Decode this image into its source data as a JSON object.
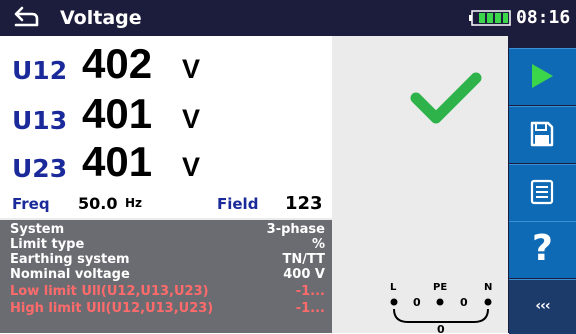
{
  "header": {
    "title": "Voltage",
    "time": "08:16",
    "back_icon": "back-arrow-icon",
    "battery_icon": "battery-icon"
  },
  "measurements": [
    {
      "name": "U12",
      "value": "402",
      "unit": "V"
    },
    {
      "name": "U13",
      "value": "401",
      "unit": "V"
    },
    {
      "name": "U23",
      "value": "401",
      "unit": "V"
    }
  ],
  "freq": {
    "label": "Freq",
    "value": "50.0",
    "unit": "Hz"
  },
  "field": {
    "label": "Field",
    "value": "123"
  },
  "params": [
    {
      "label": "System",
      "value": "3-phase"
    },
    {
      "label": "Limit type",
      "value": "%"
    },
    {
      "label": "Earthing system",
      "value": "TN/TT"
    },
    {
      "label": "Nominal voltage",
      "value": "400 V"
    },
    {
      "label": "Low limit Ull(U12,U13,U23)",
      "value": "-1..."
    },
    {
      "label": "High limit Ull(U12,U13,U23)",
      "value": "-1..."
    }
  ],
  "status_icon": "checkmark-icon",
  "wiring": {
    "labels": [
      "L",
      "PE",
      "N"
    ],
    "values": [
      "0",
      "0",
      "0"
    ]
  },
  "sidebar": {
    "start_icon": "play-icon",
    "save_icon": "save-icon",
    "list_icon": "list-icon",
    "help_label": "?",
    "more_label": "‹‹‹"
  },
  "colors": {
    "header_bg": "#1c1c3c",
    "label_blue": "#1a2a9a",
    "pass_green": "#2db34a",
    "play_green": "#3cd64a",
    "button_blue": "#0f6ab5",
    "params_bg": "#6b6b72",
    "warn_red": "#ff6b6b"
  }
}
